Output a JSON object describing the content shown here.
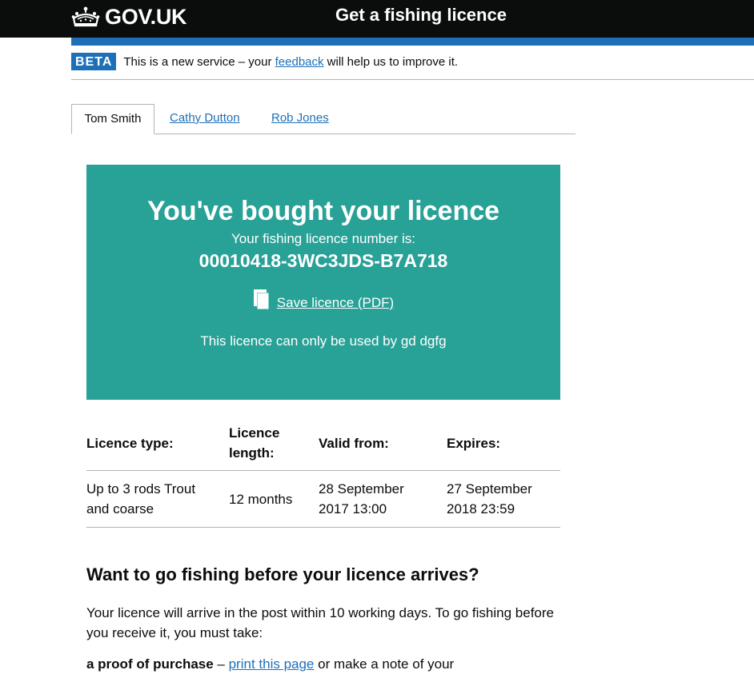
{
  "header": {
    "logo_text": "GOV.UK",
    "logo_icon": "crown-icon",
    "service_name": "Get a fishing licence"
  },
  "colors": {
    "header_bg": "#0b0c0c",
    "accent_blue": "#1d70b8",
    "panel_green": "#28a197",
    "text": "#0b0c0c",
    "border": "#b1b4b6"
  },
  "phase_banner": {
    "tag": "BETA",
    "text_before": "This is a new service – your ",
    "link_text": "feedback",
    "text_after": " will help us to improve it."
  },
  "tabs": [
    {
      "label": "Tom Smith",
      "selected": true
    },
    {
      "label": "Cathy Dutton",
      "selected": false
    },
    {
      "label": "Rob Jones",
      "selected": false
    }
  ],
  "panel": {
    "title": "You've bought your licence",
    "number_label": "Your fishing licence number is:",
    "number": "00010418-3WC3JDS-B7A718",
    "save_icon": "document-icon",
    "save_link": "Save licence (PDF)",
    "note": "This licence can only be used by gd dgfg"
  },
  "table": {
    "headers": [
      "Licence type:",
      "Licence length:",
      "Valid from:",
      "Expires:"
    ],
    "rows": [
      [
        "Up to 3 rods Trout and coarse",
        "12 months",
        "28 September 2017 13:00",
        "27 September 2018 23:59"
      ]
    ]
  },
  "section": {
    "heading": "Want to go fishing before your licence arrives?",
    "body": "Your licence will arrive in the post within 10 working days. To go fishing before you receive it, you must take:",
    "cutoff_bold": "a proof of purchase",
    "cutoff_link": "print this page",
    "cutoff_rest": " or make a note of your"
  }
}
